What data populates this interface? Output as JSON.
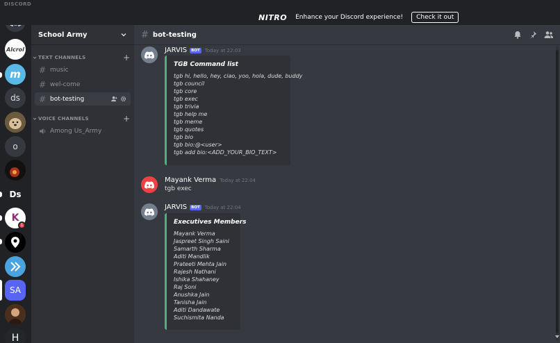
{
  "app": {
    "wordmark": "DISCORD"
  },
  "nitro": {
    "logo": "NITRO",
    "text": "Enhance your Discord experience!",
    "button": "Check it out"
  },
  "servers": [
    {
      "name": "home",
      "label": ""
    },
    {
      "name": "Alcrol",
      "label": "Alcrol"
    },
    {
      "name": "m-server",
      "label": "m"
    },
    {
      "name": "ds-server",
      "label": "ds"
    },
    {
      "name": "dog-server",
      "label": ""
    },
    {
      "name": "o-server",
      "label": "o"
    },
    {
      "name": "red-server",
      "label": ""
    },
    {
      "name": "Ds-server",
      "label": "Ds"
    },
    {
      "name": "k-server",
      "label": "K",
      "badge": "1"
    },
    {
      "name": "map-server",
      "label": ""
    },
    {
      "name": "arrow-server",
      "label": ""
    },
    {
      "name": "SA-server",
      "label": "SA"
    },
    {
      "name": "person-server",
      "label": ""
    },
    {
      "name": "H-server",
      "label": "H"
    }
  ],
  "sidebar": {
    "server_name": "School Army",
    "categories": [
      {
        "label": "TEXT CHANNELS"
      },
      {
        "label": "VOICE CHANNELS"
      }
    ],
    "text_channels": [
      "music",
      "wel-come",
      "bot-testing"
    ],
    "voice_channels": [
      "Among Us_Army"
    ]
  },
  "channel": {
    "name": "bot-testing"
  },
  "messages": [
    {
      "author": "JARVIS",
      "bot": "BOT",
      "timestamp": "Today at 22:03",
      "embed": {
        "title": "TGB Command list",
        "lines": [
          "tgb hi, hello, hey, ciao, yoo, hola, dude, buddy",
          "tgb council",
          "tgb core",
          "tgb exec",
          "tgb trivia",
          "tgb help me",
          "tgb meme",
          "tgb quotes",
          "tgb bio",
          "tgb bio:@<user>",
          "tgb add bio:<ADD_YOUR_BIO_TEXT>"
        ]
      }
    },
    {
      "author": "Mayank Verma",
      "timestamp": "Today at 22:04",
      "text": "tgb exec"
    },
    {
      "author": "JARVIS",
      "bot": "BOT",
      "timestamp": "Today at 22:04",
      "embed": {
        "title": "Executives Members",
        "lines": [
          "Mayank Verma",
          "Jaspreet Singh Saini",
          "Samarth Sharma",
          "Aditi Mandlik",
          "Prateeti Mehta Jain",
          "Rajesh Nathani",
          "Ishika Shahaney",
          "Raj Soni",
          "Anushka Jain",
          "Tanisha Jain",
          "Aditi Dandawate",
          "Suchismita Nanda"
        ]
      }
    }
  ],
  "colors": {
    "accent": "#5865f2",
    "embed_border": "#43b581",
    "danger": "#ed4245"
  }
}
